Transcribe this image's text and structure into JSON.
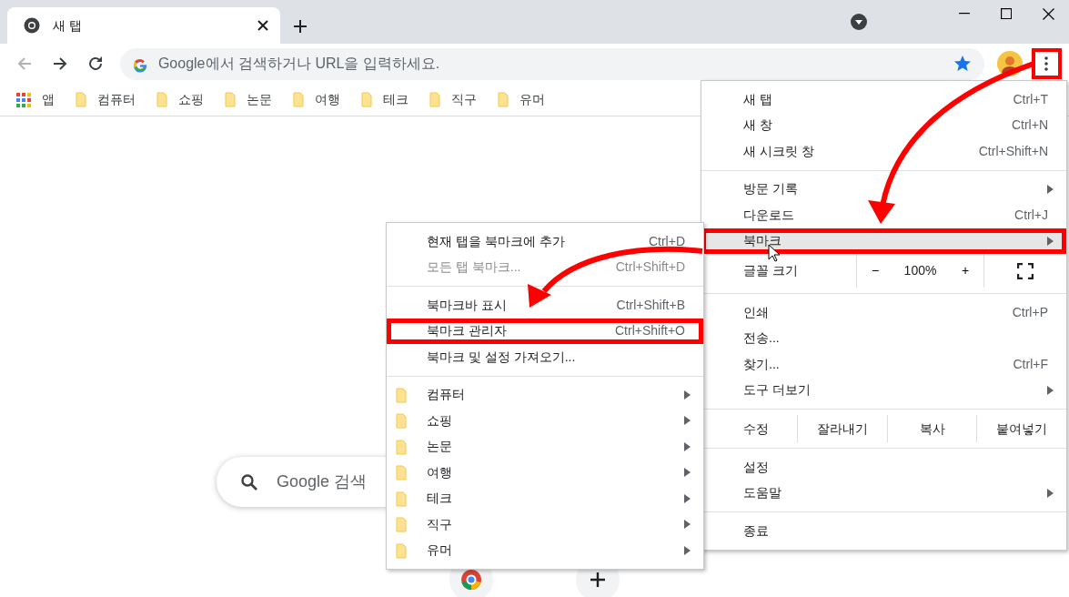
{
  "tab": {
    "title": "새 탭",
    "selected": true
  },
  "nav_buttons": [
    {
      "kind": "back",
      "disabled": true
    },
    {
      "kind": "forward",
      "disabled": false
    },
    {
      "kind": "reload",
      "disabled": false
    }
  ],
  "address_bar": {
    "placeholder": "Google에서 검색하거나 URL을 입력하세요.",
    "bookmarked": true
  },
  "menu_button": {
    "annotated": true
  },
  "bookmark_bar": [
    {
      "kind": "apps",
      "label": "앱"
    },
    {
      "kind": "folder",
      "label": "컴퓨터"
    },
    {
      "kind": "folder",
      "label": "쇼핑"
    },
    {
      "kind": "folder",
      "label": "논문"
    },
    {
      "kind": "folder",
      "label": "여행"
    },
    {
      "kind": "folder",
      "label": "테크"
    },
    {
      "kind": "folder",
      "label": "직구"
    },
    {
      "kind": "folder",
      "label": "유머"
    }
  ],
  "search_box": {
    "placeholder": "Google 검색"
  },
  "main_menu": [
    {
      "kind": "item",
      "label": "새 탭",
      "shortcut": "Ctrl+T",
      "submenu": false,
      "selected": false,
      "annotated": false
    },
    {
      "kind": "item",
      "label": "새 창",
      "shortcut": "Ctrl+N",
      "submenu": false,
      "selected": false,
      "annotated": false
    },
    {
      "kind": "item",
      "label": "새 시크릿 창",
      "shortcut": "Ctrl+Shift+N",
      "submenu": false,
      "selected": false,
      "annotated": false
    },
    {
      "kind": "separator"
    },
    {
      "kind": "item",
      "label": "방문 기록",
      "submenu": true,
      "selected": false,
      "annotated": false
    },
    {
      "kind": "item",
      "label": "다운로드",
      "shortcut": "Ctrl+J",
      "submenu": false,
      "selected": false,
      "annotated": false
    },
    {
      "kind": "item",
      "label": "북마크",
      "submenu": true,
      "selected": true,
      "annotated": true
    },
    {
      "kind": "zoom",
      "label": "글꼴 크기",
      "minus": "−",
      "value": "100%",
      "plus": "+"
    },
    {
      "kind": "separator"
    },
    {
      "kind": "item",
      "label": "인쇄",
      "shortcut": "Ctrl+P",
      "submenu": false,
      "selected": false,
      "annotated": false
    },
    {
      "kind": "item",
      "label": "전송...",
      "submenu": false,
      "selected": false,
      "annotated": false
    },
    {
      "kind": "item",
      "label": "찾기...",
      "shortcut": "Ctrl+F",
      "submenu": false,
      "selected": false,
      "annotated": false
    },
    {
      "kind": "item",
      "label": "도구 더보기",
      "submenu": true,
      "selected": false,
      "annotated": false
    },
    {
      "kind": "separator"
    },
    {
      "kind": "edit",
      "label": "수정",
      "buttons": [
        "잘라내기",
        "복사",
        "붙여넣기"
      ]
    },
    {
      "kind": "separator"
    },
    {
      "kind": "item",
      "label": "설정",
      "submenu": false,
      "selected": false,
      "annotated": false
    },
    {
      "kind": "item",
      "label": "도움말",
      "submenu": true,
      "selected": false,
      "annotated": false
    },
    {
      "kind": "separator"
    },
    {
      "kind": "item",
      "label": "종료",
      "submenu": false,
      "selected": false,
      "annotated": false
    }
  ],
  "bookmark_submenu": [
    {
      "kind": "item",
      "label": "현재 탭을 북마크에 추가",
      "shortcut": "Ctrl+D",
      "disabled": false,
      "selected": false,
      "annotated": false
    },
    {
      "kind": "item",
      "label": "모든 탭 북마크...",
      "shortcut": "Ctrl+Shift+D",
      "disabled": true,
      "selected": false,
      "annotated": false
    },
    {
      "kind": "separator"
    },
    {
      "kind": "item",
      "label": "북마크바 표시",
      "shortcut": "Ctrl+Shift+B",
      "disabled": false,
      "selected": false,
      "annotated": false
    },
    {
      "kind": "item",
      "label": "북마크 관리자",
      "shortcut": "Ctrl+Shift+O",
      "disabled": false,
      "selected": false,
      "annotated": true
    },
    {
      "kind": "item",
      "label": "북마크 및 설정 가져오기...",
      "disabled": false,
      "selected": false,
      "annotated": false
    },
    {
      "kind": "separator"
    },
    {
      "kind": "folder",
      "label": "컴퓨터",
      "selected": false
    },
    {
      "kind": "folder",
      "label": "쇼핑",
      "selected": false
    },
    {
      "kind": "folder",
      "label": "논문",
      "selected": false
    },
    {
      "kind": "folder",
      "label": "여행",
      "selected": false
    },
    {
      "kind": "folder",
      "label": "테크",
      "selected": false
    },
    {
      "kind": "folder",
      "label": "직구",
      "selected": false
    },
    {
      "kind": "folder",
      "label": "유머",
      "selected": false
    }
  ],
  "annotation_arrows": [
    {
      "kind": "curved"
    },
    {
      "kind": "curved"
    }
  ]
}
